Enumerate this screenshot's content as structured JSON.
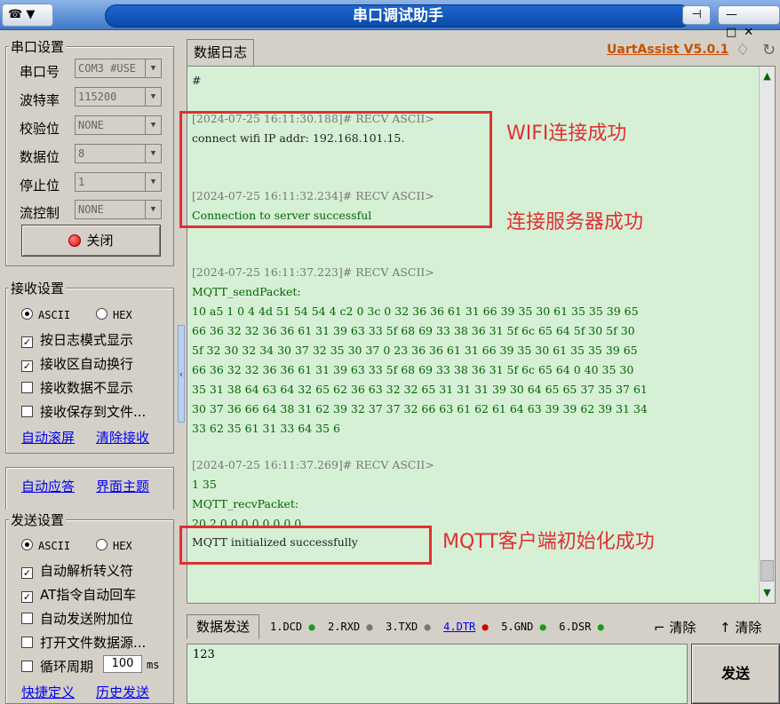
{
  "window": {
    "title": "串口调试助手",
    "menu_glyph": "▼",
    "min": "—",
    "max": "□",
    "close": "✕",
    "pin": "⊣"
  },
  "serial": {
    "group_label": "串口设置",
    "port_label": "串口号",
    "port_value": "COM3 #USE",
    "baud_label": "波特率",
    "baud_value": "115200",
    "parity_label": "校验位",
    "parity_value": "NONE",
    "databits_label": "数据位",
    "databits_value": "8",
    "stopbits_label": "停止位",
    "stopbits_value": "1",
    "flow_label": "流控制",
    "flow_value": "NONE",
    "close_button": "关闭"
  },
  "recv": {
    "group_label": "接收设置",
    "ascii": "ASCII",
    "hex": "HEX",
    "opt1": "按日志模式显示",
    "opt2": "接收区自动换行",
    "opt3": "接收数据不显示",
    "opt4": "接收保存到文件...",
    "auto_scroll": "自动滚屏",
    "clear_recv": "清除接收"
  },
  "misc": {
    "auto_reply": "自动应答",
    "theme": "界面主题"
  },
  "send": {
    "group_label": "发送设置",
    "ascii": "ASCII",
    "hex": "HEX",
    "opt1": "自动解析转义符",
    "opt2": "AT指令自动回车",
    "opt3": "自动发送附加位",
    "opt4": "打开文件数据源...",
    "opt5": "循环周期",
    "period": "100",
    "unit": "ms",
    "shortcut": "快捷定义",
    "history": "历史发送"
  },
  "log_tab": {
    "label": "数据日志",
    "version": "UartAssist V5.0.1"
  },
  "log": {
    "l0": "#",
    "l1": "[2024-07-25 16:11:30.188]# RECV ASCII>",
    "l2": "connect wifi IP addr: 192.168.101.15.",
    "l3": "[2024-07-25 16:11:32.234]# RECV ASCII>",
    "l4": "Connection to server successful",
    "l5": "[2024-07-25 16:11:37.223]# RECV ASCII>",
    "l6": "MQTT_sendPacket:",
    "l7": "10 a5 1 0 4 4d 51 54 54 4 c2 0 3c 0 32 36 36 61 31 66 39 35 30 61 35 35 39 65",
    "l8": "66 36 32 32 36 36 61 31 39 63 33 5f 68 69 33 38 36 31 5f 6c 65 64 5f 30 5f 30",
    "l9": "5f 32 30 32 34 30 37 32 35 30 37 0 23 36 36 61 31 66 39 35 30 61 35 35 39 65",
    "l10": "66 36 32 32 36 36 61 31 39 63 33 5f 68 69 33 38 36 31 5f 6c 65 64 0 40 35 30",
    "l11": "35 31 38 64 63 64 32 65 62 36 63 32 32 65 31 31 31 39 30 64 65 65 37 35 37 61",
    "l12": "30 37 36 66 64 38 31 62 39 32 37 37 32 66 63 61 62 61 64 63 39 39 62 39 31 34",
    "l13": "33 62 35 61 31 33 64 35 6",
    "l14": "[2024-07-25 16:11:37.269]# RECV ASCII>",
    "l15": "1 35",
    "l16": "MQTT_recvPacket:",
    "l17": "20 2 0 0 0 0 0 0 0 0",
    "l18": "MQTT initialized successfully"
  },
  "annotations": {
    "a1": "WIFI连接成功",
    "a2": "连接服务器成功",
    "a3": "MQTT客户端初始化成功"
  },
  "send_tab": {
    "label": "数据发送",
    "dcd": "1.DCD",
    "rxd": "2.RXD",
    "txd": "3.TXD",
    "dtr": "4.DTR",
    "gnd": "5.GND",
    "dsr": "6.DSR",
    "clear1": "清除",
    "clear2": "清除",
    "input": "123",
    "send_button": "发送"
  }
}
